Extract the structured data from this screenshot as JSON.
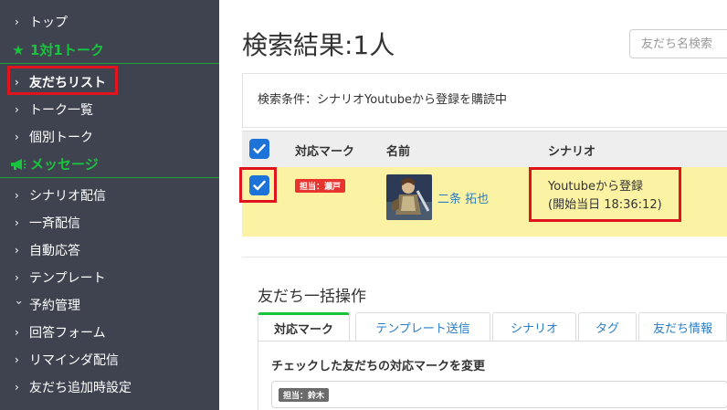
{
  "sidebar": {
    "items": [
      {
        "label": "トップ"
      },
      {
        "label": "友だちリスト"
      },
      {
        "label": "トーク一覧"
      },
      {
        "label": "個別トーク"
      },
      {
        "label": "シナリオ配信"
      },
      {
        "label": "一斉配信"
      },
      {
        "label": "自動応答"
      },
      {
        "label": "テンプレート"
      },
      {
        "label": "予約管理"
      },
      {
        "label": "回答フォーム"
      },
      {
        "label": "リマインダ配信"
      },
      {
        "label": "友だち追加時設定"
      }
    ],
    "sections": [
      {
        "label": "1対1トーク",
        "icon": "star-icon"
      },
      {
        "label": "メッセージ",
        "icon": "megaphone-icon"
      }
    ]
  },
  "main": {
    "title": "検索結果:1人",
    "search_placeholder": "友だち名検索",
    "condition": "検索条件：シナリオYoutubeから登録を購読中",
    "table": {
      "headers": [
        "対応マーク",
        "名前",
        "シナリオ"
      ],
      "rows": [
        {
          "checked": true,
          "badge": "担当：瀬戸",
          "name": "二条 拓也",
          "scenario": "Youtubeから登録",
          "scenario_start": "(開始当日 18:36:12)"
        }
      ]
    },
    "bulk": {
      "title": "友だち一括操作",
      "tabs": [
        "対応マーク",
        "テンプレート送信",
        "シナリオ",
        "タグ",
        "友だち情報"
      ],
      "active_tab": 0,
      "panel_label": "チェックした友だちの対応マークを変更",
      "selected_mark": "担当：鈴木"
    }
  },
  "colors": {
    "sidebar_bg": "#3f4350",
    "accent_green": "#19c43d",
    "highlight_red": "#e0141e",
    "checkbox_blue": "#1e73d9",
    "row_yellow": "#fbf3a3",
    "link_blue": "#2a7dc4"
  }
}
